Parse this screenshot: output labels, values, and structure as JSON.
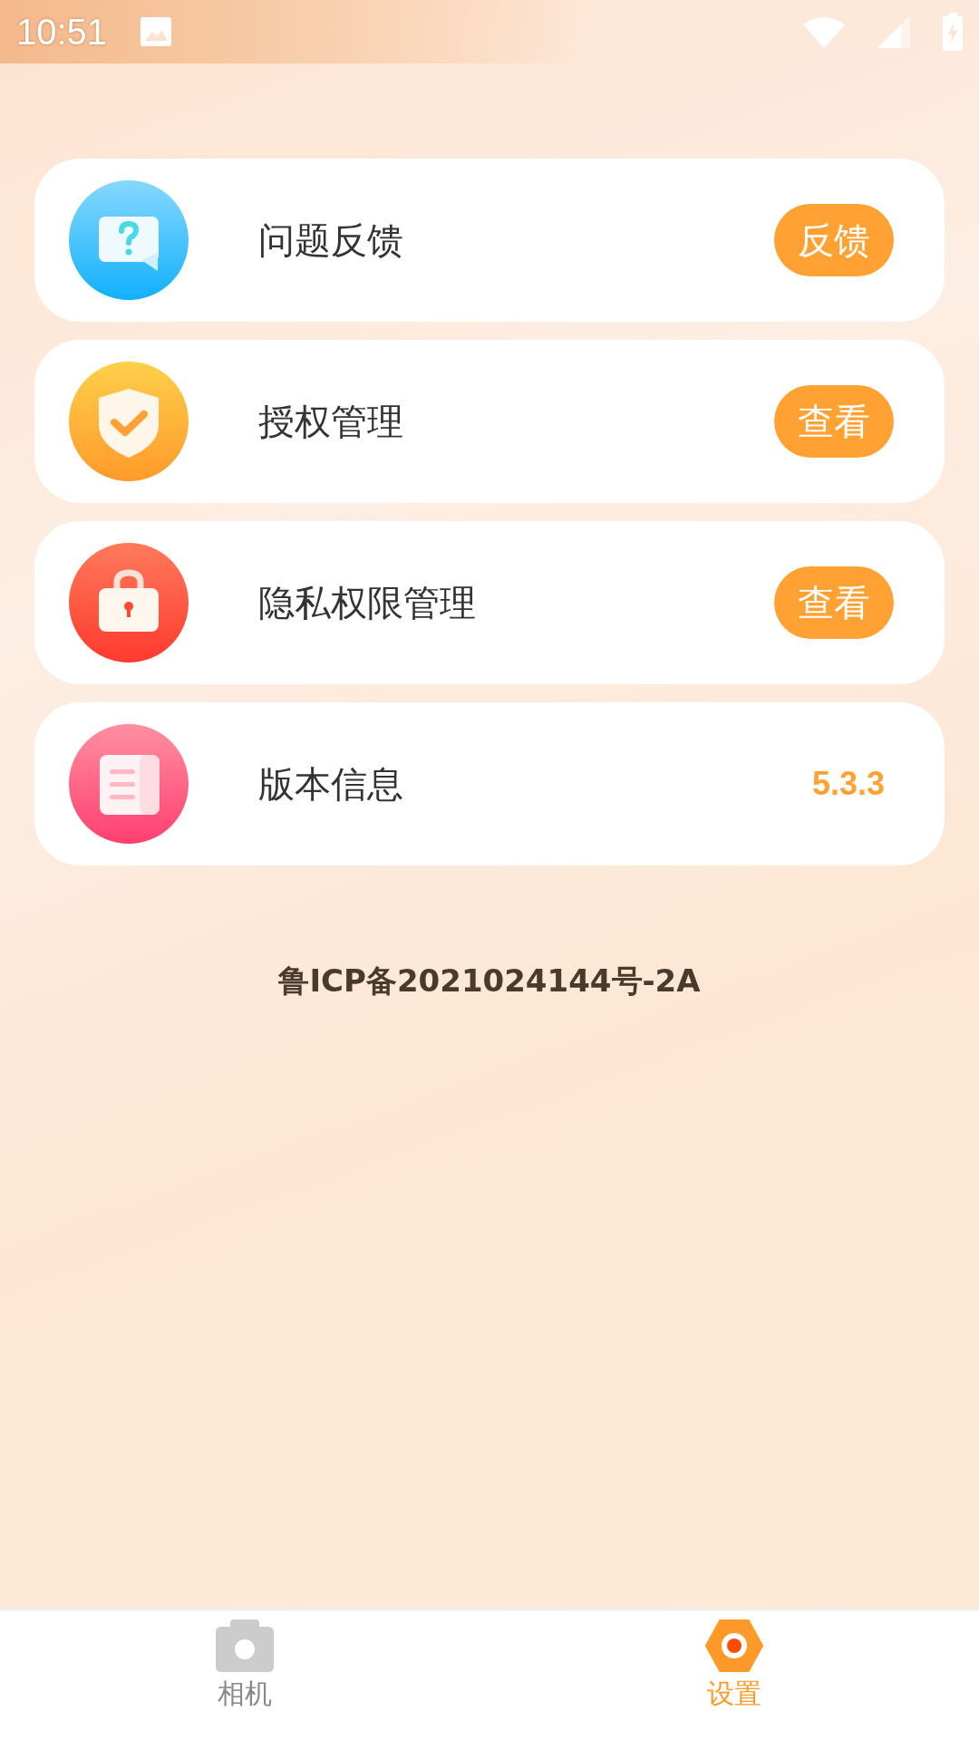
{
  "status_bar": {
    "time": "10:51"
  },
  "items": [
    {
      "label": "问题反馈",
      "kind": "button",
      "action": "反馈"
    },
    {
      "label": "授权管理",
      "kind": "button",
      "action": "查看"
    },
    {
      "label": "隐私权限管理",
      "kind": "button",
      "action": "查看"
    },
    {
      "label": "版本信息",
      "kind": "value",
      "value": "5.3.3"
    }
  ],
  "footer": "鲁ICP备2021024144号-2A",
  "tabs": [
    {
      "label": "相机",
      "selected": false
    },
    {
      "label": "设置",
      "selected": true
    }
  ]
}
